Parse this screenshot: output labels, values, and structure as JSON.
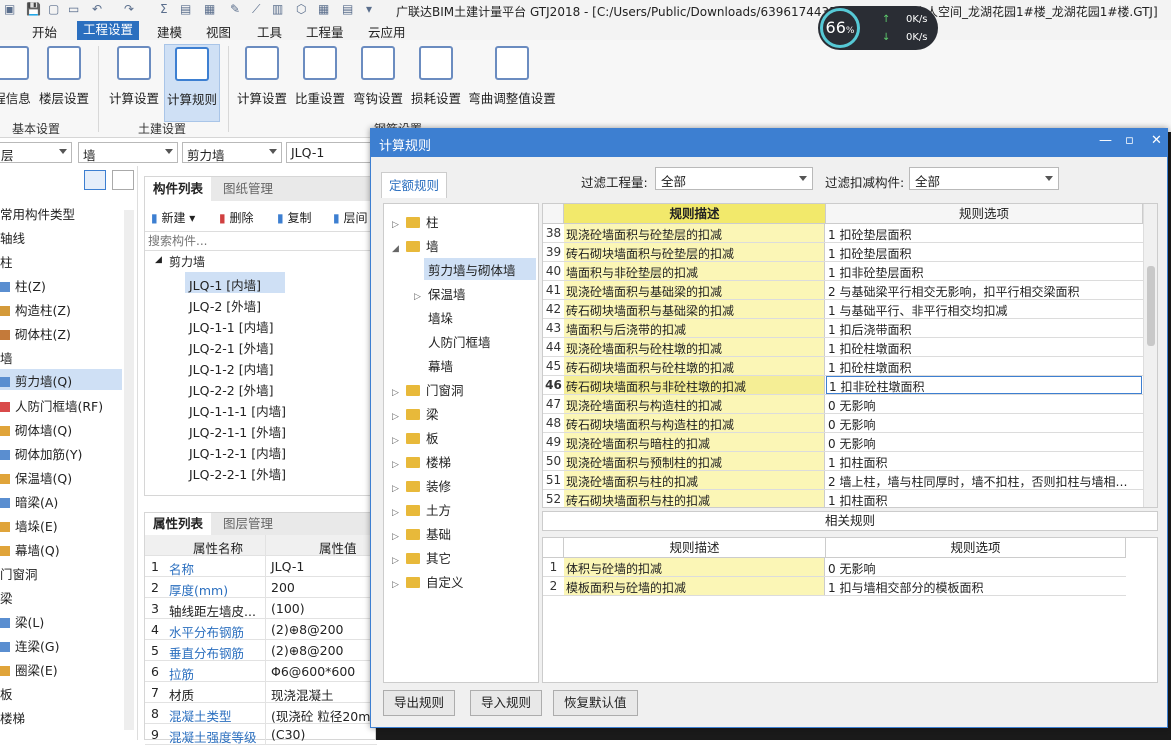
{
  "app": {
    "window_title": "广联达BIM土建计量平台 GTJ2018 - [C:/Users/Public/Downloads/63961744356503...1757(个人空间_龙湖花园1#楼_龙湖花园1#楼.GTJ]"
  },
  "menus": [
    "开始",
    "工程设置",
    "建模",
    "视图",
    "工具",
    "工程量",
    "云应用"
  ],
  "ribbon": {
    "buttons": [
      "程信息",
      "楼层设置",
      "计算设置",
      "计算规则",
      "计算设置",
      "比重设置",
      "弯钩设置",
      "损耗设置",
      "弯曲调整值设置"
    ],
    "groups": [
      "基本设置",
      "土建设置",
      "钢筋设置"
    ]
  },
  "perf": {
    "percent": "66",
    "unit": "%",
    "up": "0K/s",
    "down": "0K/s"
  },
  "selectors": {
    "floor": "层",
    "type": "墙",
    "sub": "剪力墙",
    "item": "JLQ-1"
  },
  "left_tree": [
    "常用构件类型",
    "轴线",
    "柱",
    "柱(Z)",
    "构造柱(Z)",
    "砌体柱(Z)",
    "墙",
    "剪力墙(Q)",
    "人防门框墙(RF)",
    "砌体墙(Q)",
    "砌体加筋(Y)",
    "保温墙(Q)",
    "暗梁(A)",
    "墙垛(E)",
    "幕墙(Q)",
    "门窗洞",
    "梁",
    "梁(L)",
    "连梁(G)",
    "圈梁(E)",
    "板",
    "楼梯"
  ],
  "component_list": {
    "tabs": [
      "构件列表",
      "图纸管理"
    ],
    "toolbar": [
      "新建",
      "删除",
      "复制",
      "层间"
    ],
    "search_placeholder": "搜索构件...",
    "root": "剪力墙",
    "items": [
      "JLQ-1 [内墙]",
      "JLQ-2 [外墙]",
      "JLQ-1-1 [内墙]",
      "JLQ-2-1 [外墙]",
      "JLQ-1-2 [内墙]",
      "JLQ-2-2 [外墙]",
      "JLQ-1-1-1 [内墙]",
      "JLQ-2-1-1 [外墙]",
      "JLQ-1-2-1 [内墙]",
      "JLQ-2-2-1 [外墙]"
    ]
  },
  "property_list": {
    "tabs": [
      "属性列表",
      "图层管理"
    ],
    "headers": [
      "属性名称",
      "属性值"
    ],
    "rows": [
      {
        "n": "1",
        "k": "名称",
        "v": "JLQ-1"
      },
      {
        "n": "2",
        "k": "厚度(mm)",
        "v": "200"
      },
      {
        "n": "3",
        "k": "轴线距左墙皮...",
        "v": "(100)"
      },
      {
        "n": "4",
        "k": "水平分布钢筋",
        "v": "(2)⊕8@200"
      },
      {
        "n": "5",
        "k": "垂直分布钢筋",
        "v": "(2)⊕8@200"
      },
      {
        "n": "6",
        "k": "拉筋",
        "v": "Φ6@600*600"
      },
      {
        "n": "7",
        "k": "材质",
        "v": "现浇混凝土"
      },
      {
        "n": "8",
        "k": "混凝土类型",
        "v": "(现浇砼 粒径20mm"
      },
      {
        "n": "9",
        "k": "混凝土强度等级",
        "v": "(C30)"
      }
    ]
  },
  "dialog": {
    "title": "计算规则",
    "tab": "定额规则",
    "filter1_label": "过滤工程量:",
    "filter1_value": "全部",
    "filter2_label": "过滤扣减构件:",
    "filter2_value": "全部",
    "tree": [
      "柱",
      "墙",
      "剪力墙与砌体墙",
      "保温墙",
      "墙垛",
      "人防门框墙",
      "幕墙",
      "门窗洞",
      "梁",
      "板",
      "楼梯",
      "装修",
      "土方",
      "基础",
      "其它",
      "自定义"
    ],
    "headers": [
      "规则描述",
      "规则选项"
    ],
    "rules": [
      {
        "n": "38",
        "d": "现浇砼墙面积与砼垫层的扣减",
        "o": "1  扣砼垫层面积"
      },
      {
        "n": "39",
        "d": "砖石砌块墙面积与砼垫层的扣减",
        "o": "1  扣砼垫层面积"
      },
      {
        "n": "40",
        "d": "墙面积与非砼垫层的扣减",
        "o": "1  扣非砼垫层面积"
      },
      {
        "n": "41",
        "d": "现浇砼墙面积与基础梁的扣减",
        "o": "2  与基础梁平行相交无影响，扣平行相交梁面积"
      },
      {
        "n": "42",
        "d": "砖石砌块墙面积与基础梁的扣减",
        "o": "1  与基础平行、非平行相交均扣减"
      },
      {
        "n": "43",
        "d": "墙面积与后浇带的扣减",
        "o": "1    扣后浇带面积"
      },
      {
        "n": "44",
        "d": "现浇砼墙面积与砼柱墩的扣减",
        "o": "1  扣砼柱墩面积"
      },
      {
        "n": "45",
        "d": "砖石砌块墙面积与砼柱墩的扣减",
        "o": "1  扣砼柱墩面积"
      },
      {
        "n": "46",
        "d": "砖石砌块墙面积与非砼柱墩的扣减",
        "o": "1  扣非砼柱墩面积"
      },
      {
        "n": "47",
        "d": "现浇砼墙面积与构造柱的扣减",
        "o": "0  无影响"
      },
      {
        "n": "48",
        "d": "砖石砌块墙面积与构造柱的扣减",
        "o": "0  无影响"
      },
      {
        "n": "49",
        "d": "现浇砼墙面积与暗柱的扣减",
        "o": "0  无影响"
      },
      {
        "n": "50",
        "d": "现浇砼墙面积与预制柱的扣减",
        "o": "1  扣柱面积"
      },
      {
        "n": "51",
        "d": "现浇砼墙面积与柱的扣减",
        "o": "2  墙上柱，墙与柱同厚时，墙不扣柱，否则扣柱与墙相…"
      },
      {
        "n": "52",
        "d": "砖石砌块墙面积与柱的扣减",
        "o": "1  扣柱面积"
      }
    ],
    "related_label": "相关规则",
    "related_rules": [
      {
        "n": "1",
        "d": "体积与砼墙的扣减",
        "o": "0  无影响"
      },
      {
        "n": "2",
        "d": "模板面积与砼墙的扣减",
        "o": "1  扣与墙相交部分的模板面积"
      }
    ],
    "buttons": [
      "导出规则",
      "导入规则",
      "恢复默认值"
    ]
  }
}
